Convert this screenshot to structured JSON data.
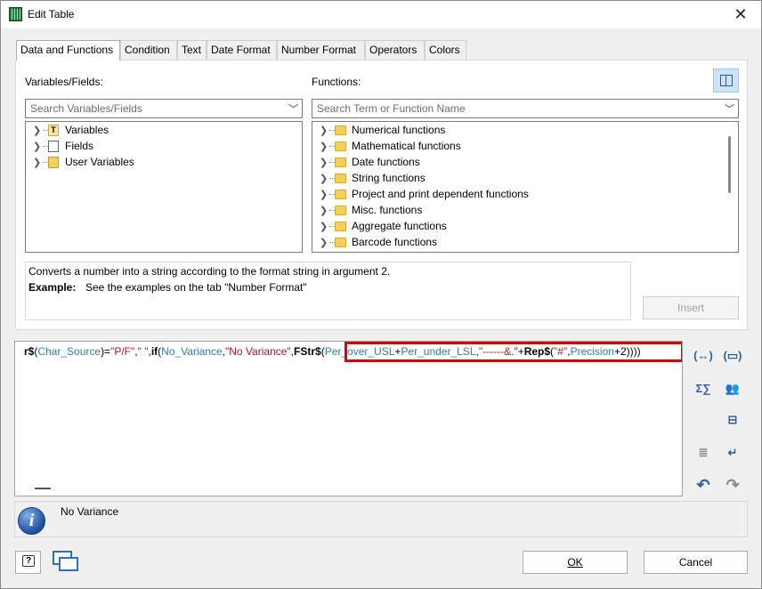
{
  "window": {
    "title": "Edit Table",
    "close_glyph": "✕"
  },
  "tabs": [
    {
      "label": "Data and Functions",
      "active": true
    },
    {
      "label": "Condition"
    },
    {
      "label": "Text"
    },
    {
      "label": "Date Format"
    },
    {
      "label": "Number Format"
    },
    {
      "label": "Operators"
    },
    {
      "label": "Colors"
    }
  ],
  "variables": {
    "label": "Variables/Fields:",
    "search_placeholder": "Search Variables/Fields",
    "items": [
      {
        "label": "Variables",
        "icon": "variable-icon"
      },
      {
        "label": "Fields",
        "icon": "field-icon"
      },
      {
        "label": "User Variables",
        "icon": "user-variable-icon"
      }
    ]
  },
  "functions": {
    "label": "Functions:",
    "search_placeholder": "Search Term or Function Name",
    "items": [
      {
        "label": "Numerical functions"
      },
      {
        "label": "Mathematical functions"
      },
      {
        "label": "Date functions"
      },
      {
        "label": "String functions"
      },
      {
        "label": "Project and print dependent functions"
      },
      {
        "label": "Misc. functions"
      },
      {
        "label": "Aggregate functions"
      },
      {
        "label": "Barcode functions"
      }
    ]
  },
  "description": {
    "text": "Converts a number into a string according to the format string in argument 2.",
    "example_label": "Example:",
    "example_text": "See the examples on the tab \"Number Format\""
  },
  "insert_button": "Insert",
  "editor": {
    "tokens": [
      {
        "t": "r$",
        "c": "k"
      },
      {
        "t": "(",
        "c": "p"
      },
      {
        "t": "Char_Source",
        "c": "v"
      },
      {
        "t": ")=",
        "c": "p"
      },
      {
        "t": "\"P/F\"",
        "c": "s"
      },
      {
        "t": ",",
        "c": "p"
      },
      {
        "t": "\" \"",
        "c": "s"
      },
      {
        "t": ",",
        "c": "p"
      },
      {
        "t": "if",
        "c": "k"
      },
      {
        "t": "(",
        "c": "p"
      },
      {
        "t": "No_Variance",
        "c": "v"
      },
      {
        "t": ",",
        "c": "p"
      },
      {
        "t": "\"No Variance\"",
        "c": "s"
      },
      {
        "t": ",",
        "c": "p"
      },
      {
        "t": "FStr$",
        "c": "k"
      },
      {
        "t": "(",
        "c": "p"
      },
      {
        "t": "Per_over_USL",
        "c": "v"
      },
      {
        "t": "+",
        "c": "p"
      },
      {
        "t": "Per_under_LSL",
        "c": "v"
      },
      {
        "t": ",",
        "c": "p"
      },
      {
        "t": "\"------&.\"",
        "c": "s"
      },
      {
        "t": "+",
        "c": "p"
      },
      {
        "t": "Rep$",
        "c": "k"
      },
      {
        "t": "(",
        "c": "p"
      },
      {
        "t": "\"#\"",
        "c": "s"
      },
      {
        "t": ",",
        "c": "p"
      },
      {
        "t": "Precision",
        "c": "v"
      },
      {
        "t": "+2))))",
        "c": "p"
      }
    ]
  },
  "toolbar_icons": {
    "wrap": "(↔)",
    "format": "(▭)",
    "sum": "Σ∑",
    "users": "👥",
    "insert_field": "⊟",
    "indent": "≣",
    "outdent": "↵",
    "undo": "↶",
    "redo": "↷"
  },
  "info": {
    "text": "No Variance",
    "glyph": "i"
  },
  "help_glyph": "?",
  "buttons": {
    "ok": "OK",
    "cancel": "Cancel"
  }
}
